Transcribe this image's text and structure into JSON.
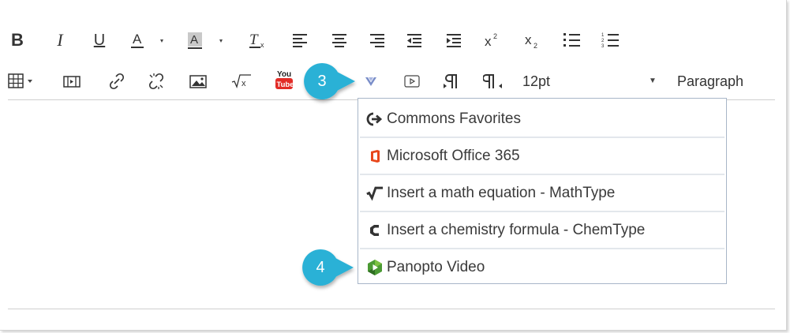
{
  "toolbar": {
    "row1": {
      "bold": "B",
      "italic": "I",
      "underline": "U"
    },
    "font_size": "12pt",
    "format_select": "Paragraph",
    "youtube_logo": {
      "top": "You",
      "bottom": "Tube"
    }
  },
  "dropdown": {
    "items": [
      {
        "label": "Commons Favorites",
        "icon": "commons-favorites-icon"
      },
      {
        "label": "Microsoft Office 365",
        "icon": "office-365-icon"
      },
      {
        "label": "Insert a math equation - MathType",
        "icon": "mathtype-icon"
      },
      {
        "label": "Insert a chemistry formula - ChemType",
        "icon": "chemtype-icon"
      },
      {
        "label": "Panopto Video",
        "icon": "panopto-icon"
      }
    ]
  },
  "callouts": {
    "step3": "3",
    "step4": "4"
  },
  "colors": {
    "callout": "#29b1d6",
    "office": "#e8461b",
    "panopto_green": "#4b9a34",
    "menu_border": "#a8b6c8",
    "lti_chevron": "#7a8ec9"
  }
}
